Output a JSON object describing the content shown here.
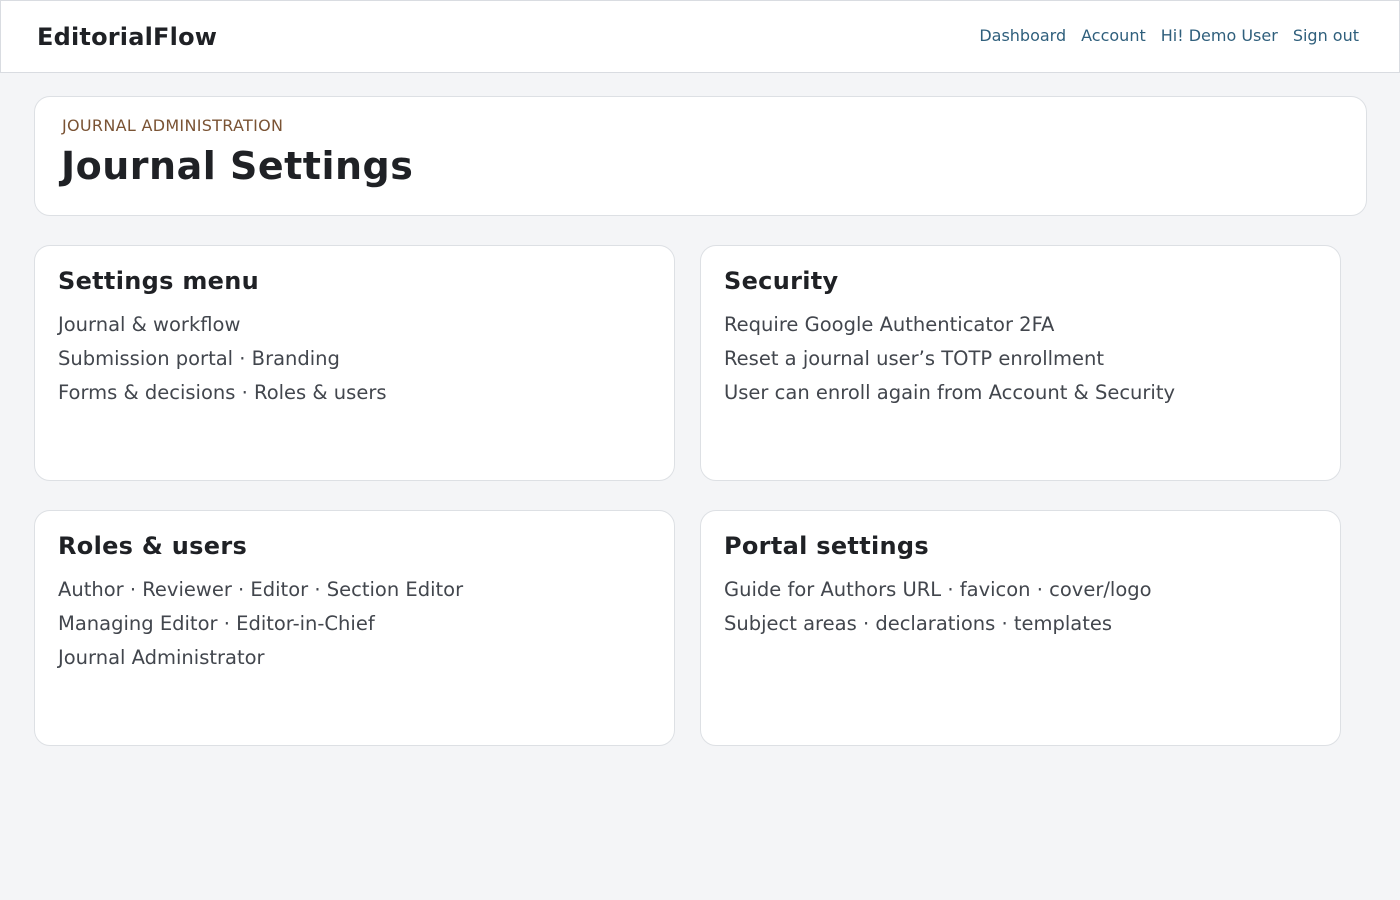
{
  "app": {
    "brand": "EditorialFlow"
  },
  "nav": {
    "items": [
      "Dashboard",
      "Account",
      "Hi! Demo User",
      "Sign out"
    ]
  },
  "header": {
    "eyebrow": "JOURNAL ADMINISTRATION",
    "title": "Journal Settings"
  },
  "cards": [
    {
      "title": "Settings menu",
      "lines": [
        "Journal & workflow",
        "Submission portal · Branding",
        "Forms & decisions · Roles & users"
      ]
    },
    {
      "title": "Security",
      "lines": [
        "Require Google Authenticator 2FA",
        "Reset a journal user’s TOTP enrollment",
        "User can enroll again from Account & Security"
      ]
    },
    {
      "title": "Roles & users",
      "lines": [
        "Author · Reviewer · Editor · Section Editor",
        "Managing Editor · Editor-in-Chief",
        "Journal Administrator"
      ]
    },
    {
      "title": "Portal settings",
      "lines": [
        "Guide for Authors URL · favicon · cover/logo",
        "Subject areas · declarations · templates"
      ]
    }
  ]
}
